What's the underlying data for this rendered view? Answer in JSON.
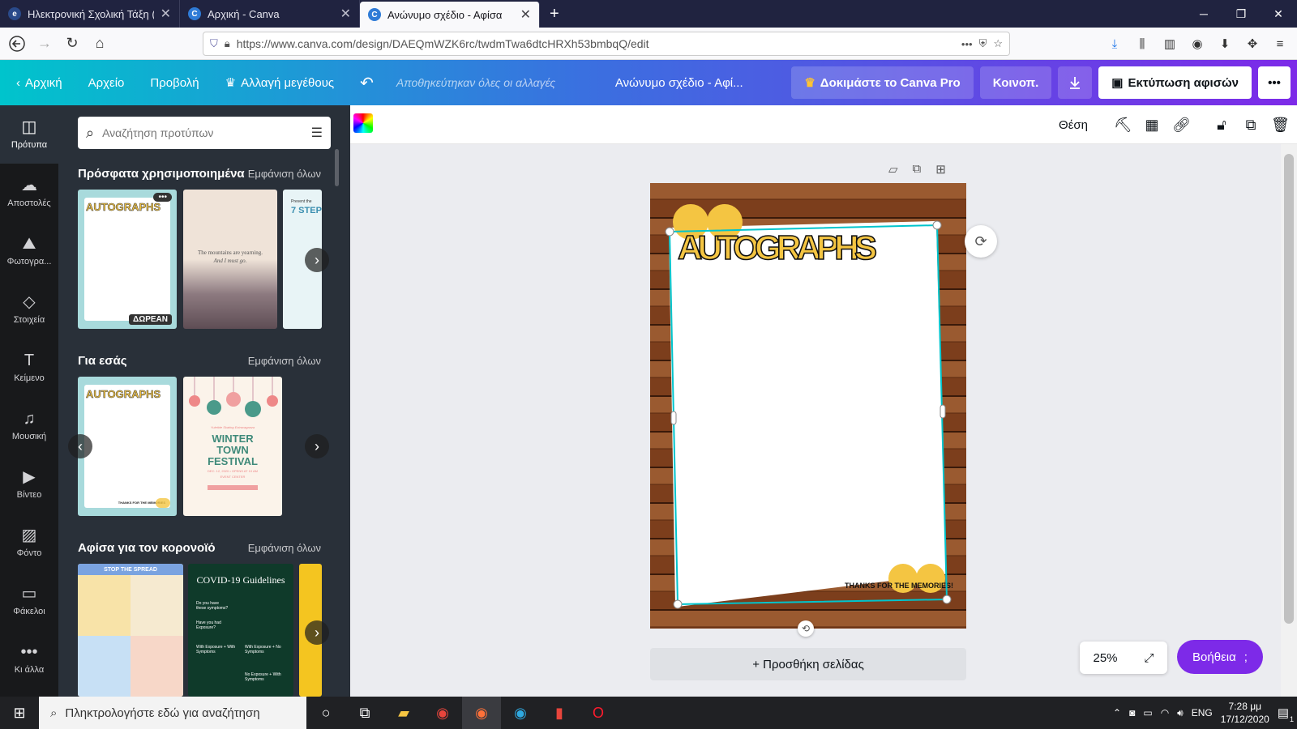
{
  "browser": {
    "tabs": [
      {
        "title": "Ηλεκτρονική Σχολική Τάξη (η-Τ",
        "favicon": "eclass-icon",
        "active": false
      },
      {
        "title": "Αρχική - Canva",
        "favicon": "canva-icon",
        "active": false
      },
      {
        "title": "Ανώνυμο σχέδιο - Αφίσα",
        "favicon": "canva-icon",
        "active": true
      }
    ],
    "url": "https://www.canva.com/design/DAEQmWZK6rc/twdmTwa6dtcHRXh53bmbqQ/edit"
  },
  "header": {
    "home": "Αρχική",
    "file": "Αρχείο",
    "view": "Προβολή",
    "resize": "Αλλαγή μεγέθους",
    "saved": "Αποθηκεύτηκαν όλες οι αλλαγές",
    "title": "Ανώνυμο σχέδιο - Αφί...",
    "try_pro": "Δοκιμάστε το Canva Pro",
    "share": "Κοινοπ.",
    "print": "Εκτύπωση αφισών",
    "colors": {
      "start": "#00c4cc",
      "end": "#7d2ae8"
    }
  },
  "rail": [
    {
      "label": "Πρότυπα",
      "icon": "templates-icon",
      "active": true
    },
    {
      "label": "Αποστολές",
      "icon": "upload-cloud-icon",
      "active": false
    },
    {
      "label": "Φωτογρα...",
      "icon": "photo-icon",
      "active": false
    },
    {
      "label": "Στοιχεία",
      "icon": "elements-icon",
      "active": false
    },
    {
      "label": "Κείμενο",
      "icon": "text-icon",
      "active": false
    },
    {
      "label": "Μουσική",
      "icon": "music-icon",
      "active": false
    },
    {
      "label": "Βίντεο",
      "icon": "video-icon",
      "active": false
    },
    {
      "label": "Φόντο",
      "icon": "background-icon",
      "active": false
    },
    {
      "label": "Φάκελοι",
      "icon": "folder-icon",
      "active": false
    },
    {
      "label": "Κι άλλα",
      "icon": "more-icon",
      "active": false
    }
  ],
  "panel": {
    "search_placeholder": "Αναζήτηση προτύπων",
    "sections": [
      {
        "title": "Πρόσφατα χρησιμοποιημένα",
        "see_all": "Εμφάνιση όλων"
      },
      {
        "title": "Για εσάς",
        "see_all": "Εμφάνιση όλων"
      },
      {
        "title": "Αφίσα για τον κορονοϊό",
        "see_all": "Εμφάνιση όλων"
      }
    ],
    "free_badge": "ΔΩΡΕΑΝ",
    "thumb_texts": {
      "autographs": "AUTOGRAPHS",
      "mountains": "The mountains are yearning.",
      "mountains2": "And I must go.",
      "steps_head": "Prevent the",
      "steps": "7 STEP",
      "winter": "WINTER TOWN FESTIVAL",
      "winter_small": "Yuletide Skating Extravaganza",
      "winter_date": "DEC. 12, 2020 • OPENS AT 10 AM",
      "winter_venue": "EVENT CENTER",
      "thanks_small": "THANKS FOR THE MEMORIES",
      "stop": "STOP THE SPREAD",
      "covid": "COVID-19 Guidelines",
      "covid_q1": "Do you have these symptoms?",
      "covid_q2": "Have you had Exposure?",
      "covid_a1": "With Exposure + With Symptoms",
      "covid_a2": "With Exposure + No Symptoms",
      "covid_a3": "No Exposure + With Symptoms"
    }
  },
  "toolbar": {
    "position": "Θέση"
  },
  "canvas": {
    "title": "AUTOGRAPHS",
    "footer": "THANKS FOR THE MEMORIES!",
    "add_page": "+ Προσθήκη σελίδας",
    "zoom": "25%",
    "help": "Βοήθεια"
  },
  "taskbar": {
    "search_placeholder": "Πληκτρολογήστε εδώ για αναζήτηση",
    "lang": "ENG",
    "time": "7:28 μμ",
    "date": "17/12/2020",
    "notifications": "1"
  }
}
